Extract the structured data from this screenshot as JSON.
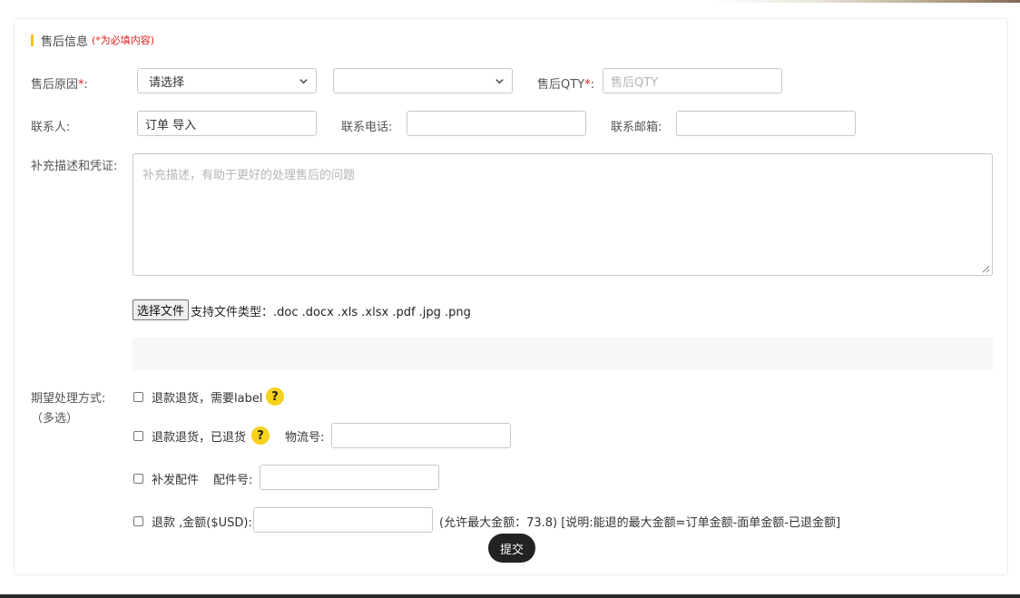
{
  "section": {
    "title": "售后信息",
    "required_note": "(*为必填内容)"
  },
  "reason": {
    "label": "售后原因",
    "required_mark": "*",
    "colon": ":",
    "select_value": "请选择",
    "sub_select_value": ""
  },
  "qty": {
    "label": "售后QTY",
    "required_mark": "*",
    "colon": ":",
    "placeholder": "售后QTY"
  },
  "contact": {
    "label": "联系人:",
    "value": "订单 导入"
  },
  "phone": {
    "label": "联系电话:",
    "value": ""
  },
  "email": {
    "label": "联系邮箱:",
    "value": ""
  },
  "description": {
    "label": "补充描述和凭证:",
    "placeholder": "补充描述，有助于更好的处理售后的问题"
  },
  "upload": {
    "button_label": "选择文件",
    "hint": "支持文件类型：.doc .docx .xls .xlsx .pdf .jpg .png"
  },
  "expect": {
    "label": "期望处理方式:",
    "sublabel": "（多选）",
    "options": [
      {
        "label": "退款退货，需要label",
        "help": "?"
      },
      {
        "label": "退款退货，已退货",
        "help": "?",
        "field_label": "物流号:",
        "field_value": ""
      },
      {
        "label": "补发配件",
        "field_label": "配件号:",
        "field_value": ""
      },
      {
        "label": "退款 ,金额($USD):",
        "field_value": "",
        "note": "(允许最大金额：73.8)  [说明:能退的最大金额=订单金额-面单金额-已退金额]"
      }
    ]
  },
  "submit": {
    "label": "提交"
  }
}
